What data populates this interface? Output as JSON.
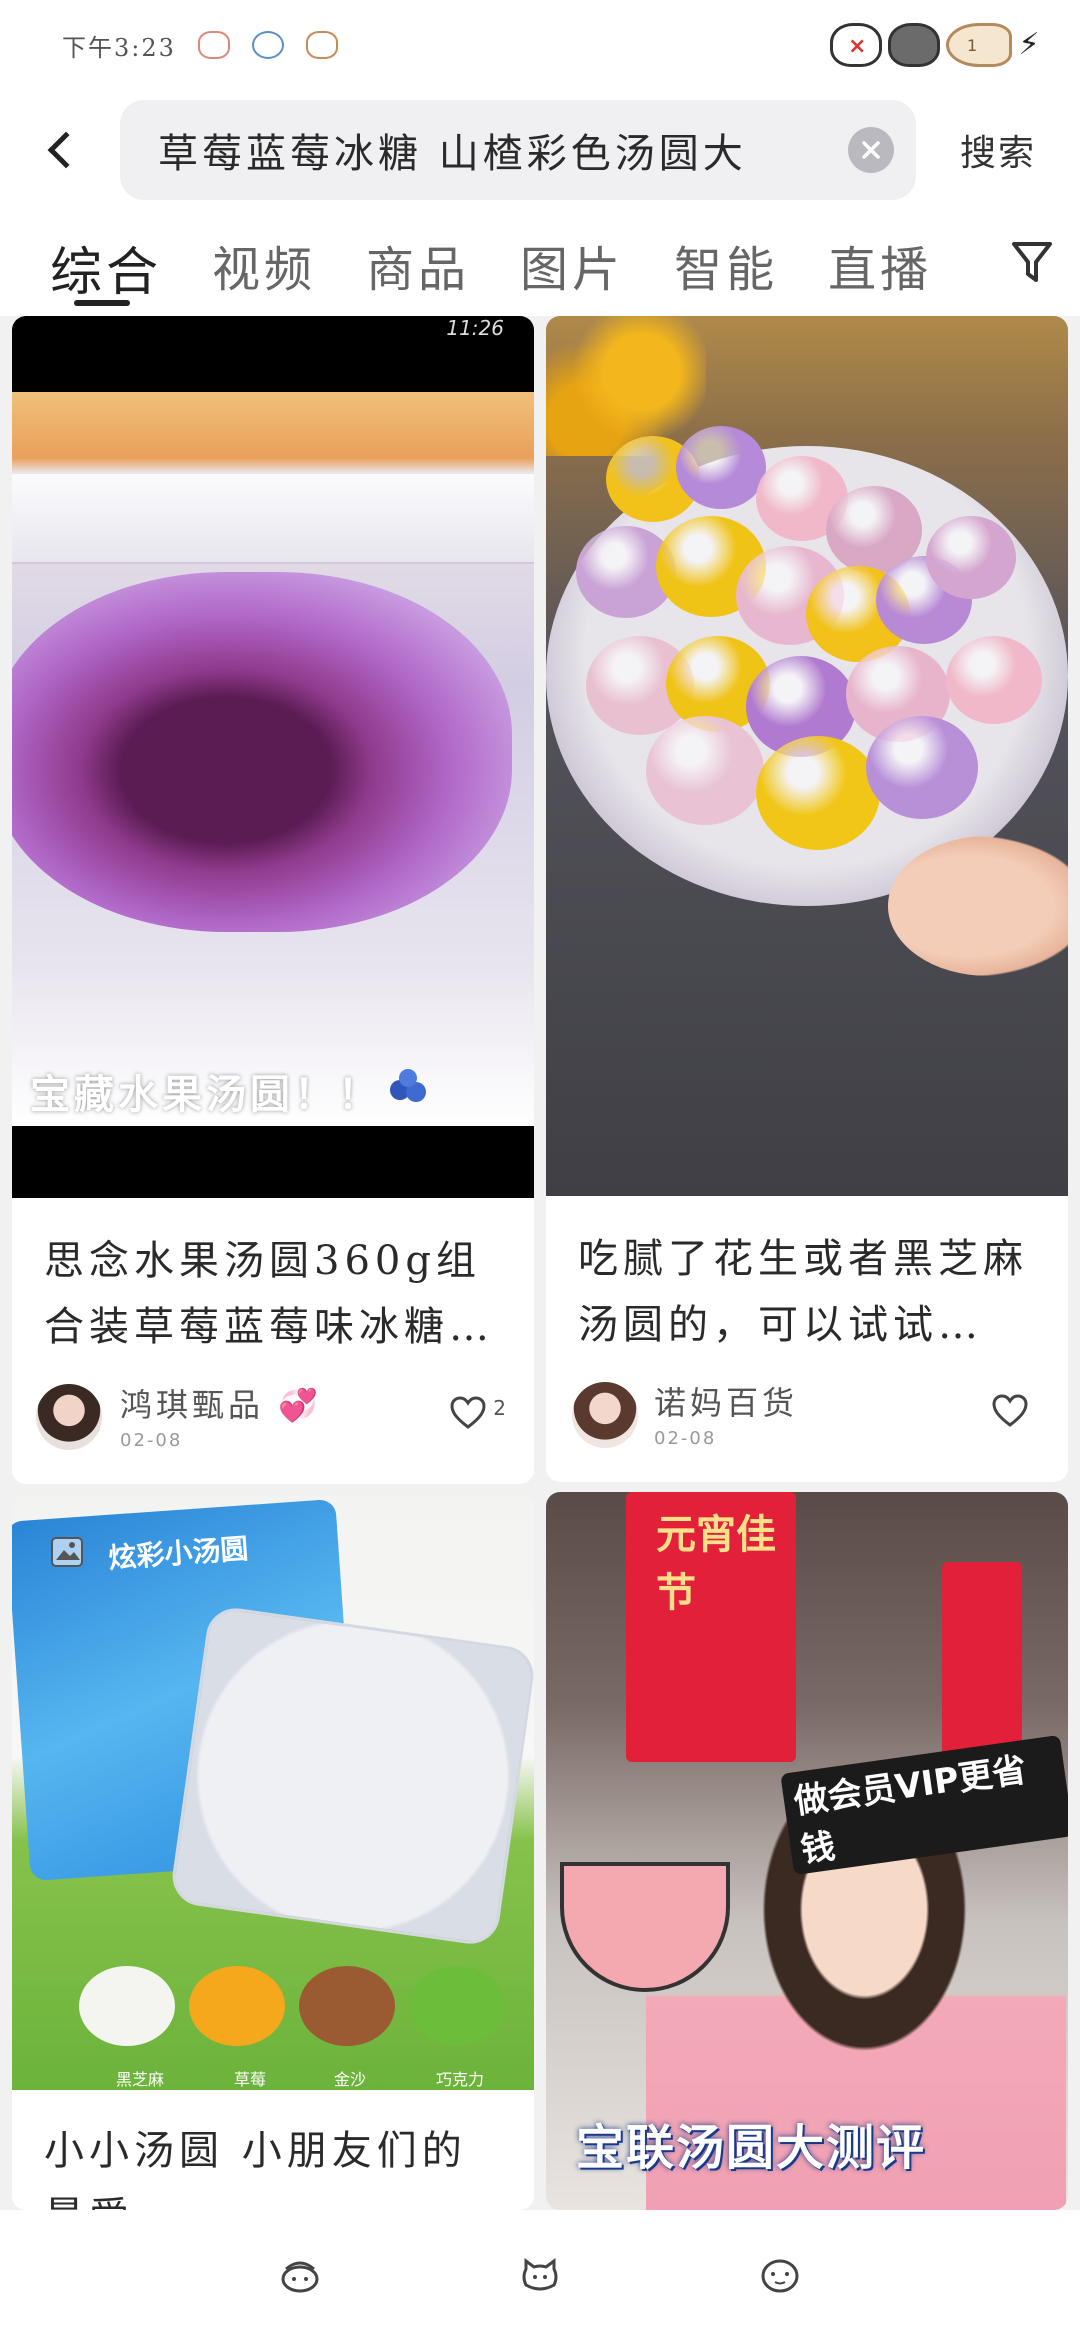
{
  "status_bar": {
    "time": "下午3:23",
    "sticker_badge_number": "1"
  },
  "search": {
    "query": "草莓蓝莓冰糖 山楂彩色汤圆大",
    "clear_icon": "close-icon",
    "submit_label": "搜索"
  },
  "tabs": [
    {
      "label": "综合",
      "active": true
    },
    {
      "label": "视频",
      "active": false
    },
    {
      "label": "商品",
      "active": false
    },
    {
      "label": "图片",
      "active": false
    },
    {
      "label": "智能",
      "active": false
    },
    {
      "label": "直播",
      "active": false
    }
  ],
  "feed": [
    {
      "title": "思念水果汤圆360g组合装草莓蓝莓味冰糖…",
      "image_overlay_text": "宝藏水果汤圆！！",
      "video_timer": "11:26",
      "author": "鸿琪甄品",
      "date": "02-08",
      "likes": "2"
    },
    {
      "title": "吃腻了花生或者黑芝麻汤圆的，可以试试…",
      "author": "诺妈百货",
      "date": "02-08"
    },
    {
      "title": "小小汤圆 小朋友们的最爱",
      "package_label": "炫彩小汤圆",
      "flavors": [
        "黑芝麻",
        "草莓",
        "金沙",
        "巧克力"
      ]
    },
    {
      "image_overlay_text": "宝联汤圆大测评",
      "sticker_text": "做会员VIP更省钱",
      "banner_text": "元宵佳节"
    }
  ],
  "colors": {
    "background": "#f1f1f1",
    "text_primary": "#222222",
    "search_box": "#f0f0f2",
    "clear_button": "#b9b9bf"
  }
}
